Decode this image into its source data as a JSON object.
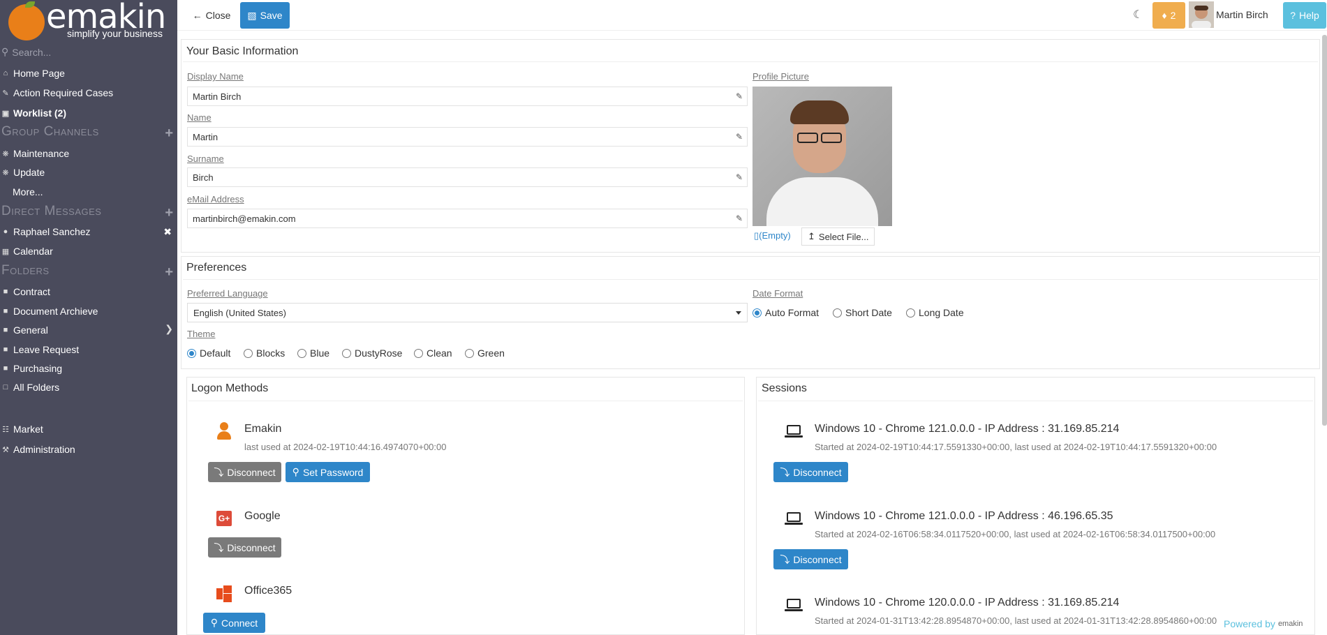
{
  "brand": {
    "name": "emakin",
    "tagline": "simplify your business"
  },
  "sidebar": {
    "search_placeholder": "Search...",
    "items": {
      "home": "Home Page",
      "action": "Action Required Cases",
      "worklist": "Worklist (2)",
      "maintenance": "Maintenance",
      "update": "Update",
      "more": "More...",
      "raphael": "Raphael Sanchez",
      "calendar": "Calendar",
      "contract": "Contract",
      "docarchive": "Document Archieve",
      "general": "General",
      "leave": "Leave Request",
      "purchasing": "Purchasing",
      "allfolders": "All Folders",
      "market": "Market",
      "administration": "Administration"
    },
    "sections": {
      "group": "Group Channels",
      "direct": "Direct Messages",
      "folders": "Folders"
    }
  },
  "toolbar": {
    "close_label": "Close",
    "save_label": "Save",
    "notification_count": "2",
    "user_name": "Martin Birch",
    "help_label": "Help"
  },
  "basic": {
    "title": "Your Basic Information",
    "display_name_label": "Display Name",
    "display_name": "Martin Birch",
    "name_label": "Name",
    "name": "Martin",
    "surname_label": "Surname",
    "surname": "Birch",
    "email_label": "eMail Address",
    "email": "martinbirch@emakin.com",
    "picture_label": "Profile Picture",
    "empty_label": "(Empty)",
    "select_file_label": "Select File..."
  },
  "prefs": {
    "title": "Preferences",
    "language_label": "Preferred Language",
    "language": "English (United States)",
    "date_format_label": "Date Format",
    "date_formats": [
      "Auto Format",
      "Short Date",
      "Long Date"
    ],
    "date_format_selected": "Auto Format",
    "theme_label": "Theme",
    "themes": [
      "Default",
      "Blocks",
      "Blue",
      "DustyRose",
      "Clean",
      "Green"
    ],
    "theme_selected": "Default"
  },
  "logon": {
    "title": "Logon Methods",
    "methods": [
      {
        "name": "Emakin",
        "last_used": "last used at 2024-02-19T10:44:16.4974070+00:00"
      },
      {
        "name": "Google"
      },
      {
        "name": "Office365"
      }
    ],
    "disconnect_label": "Disconnect",
    "set_password_label": "Set Password",
    "connect_label": "Connect"
  },
  "sessions": {
    "title": "Sessions",
    "items": [
      {
        "title": "Windows 10 - Chrome 121.0.0.0 - IP Address : 31.169.85.214",
        "detail": "Started at 2024-02-19T10:44:17.5591330+00:00, last used at 2024-02-19T10:44:17.5591320+00:00"
      },
      {
        "title": "Windows 10 - Chrome 121.0.0.0 - IP Address : 46.196.65.35",
        "detail": "Started at 2024-02-16T06:58:34.0117520+00:00, last used at 2024-02-16T06:58:34.0117500+00:00"
      },
      {
        "title": "Windows 10 - Chrome 120.0.0.0 - IP Address : 31.169.85.214",
        "detail": "Started at 2024-01-31T13:42:28.8954870+00:00, last used at 2024-01-31T13:42:28.8954860+00:00"
      }
    ],
    "disconnect_label": "Disconnect"
  },
  "footer": {
    "powered_label": "Powered by",
    "powered_brand": "emakin"
  },
  "colors": {
    "sidebar": "#4a4b5c",
    "primary": "#2e86c9",
    "warning": "#f0ad4e",
    "info": "#5bc0de",
    "brand_orange": "#e97f19"
  }
}
